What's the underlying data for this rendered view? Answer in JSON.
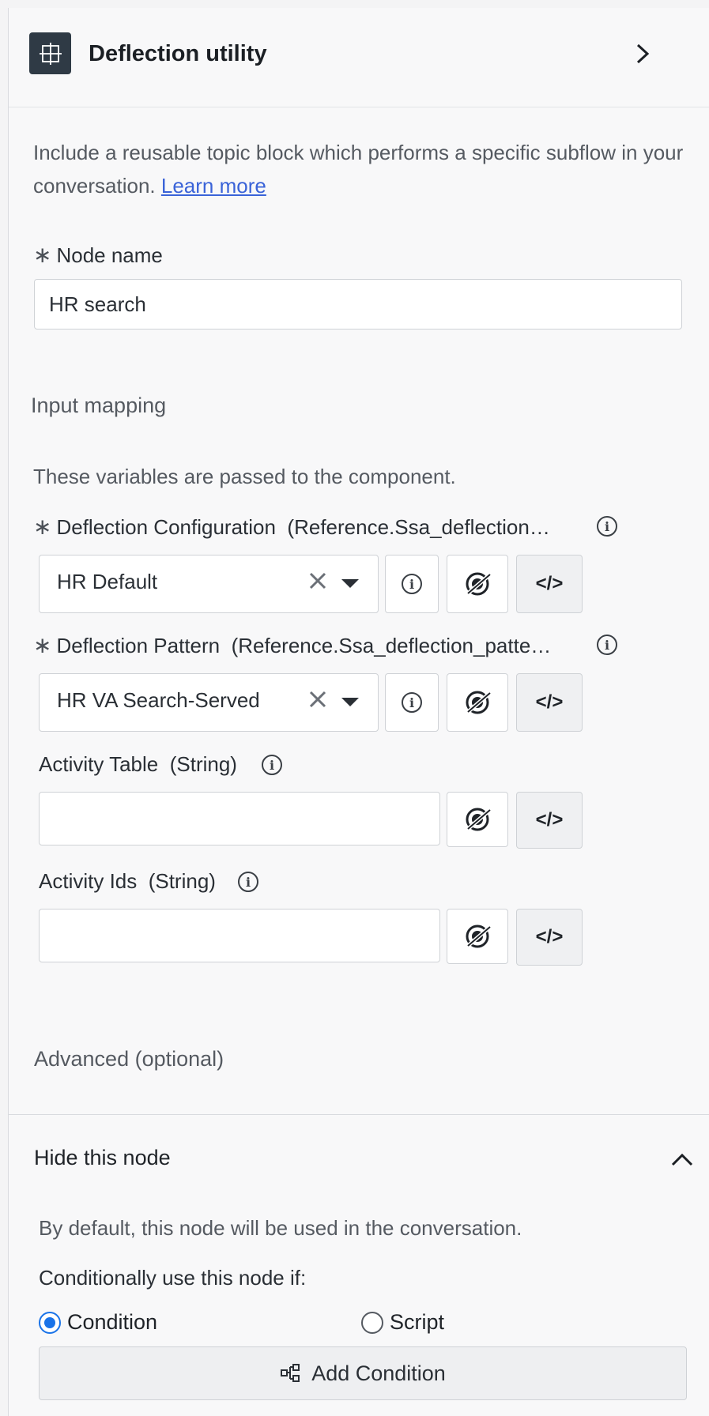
{
  "header": {
    "title": "Deflection utility",
    "icon": "grid-block-icon",
    "expand_icon": "chevron-right-icon"
  },
  "description": {
    "text": "Include a reusable topic block which performs a specific subflow in your conversation.",
    "link": "Learn more"
  },
  "node_name": {
    "required_mark": "∗",
    "label": "Node name",
    "value": "HR search"
  },
  "input_mapping": {
    "title": "Input mapping",
    "subtitle": "These variables are passed to the component.",
    "fields": [
      {
        "required_mark": "∗",
        "label": "Deflection Configuration",
        "type": "(Reference.Ssa_deflection…",
        "value": "HR Default"
      },
      {
        "required_mark": "∗",
        "label": "Deflection Pattern",
        "type": "(Reference.Ssa_deflection_patte…",
        "value": "HR VA Search-Served"
      },
      {
        "label": "Activity Table",
        "type": "(String)",
        "value": ""
      },
      {
        "label": "Activity Ids",
        "type": "(String)",
        "value": ""
      }
    ],
    "code_symbol": "</>"
  },
  "advanced": {
    "title": "Advanced (optional)"
  },
  "hide_node": {
    "title": "Hide this node",
    "default_text": "By default, this node will be used in the conversation.",
    "condition_prompt": "Conditionally use this node if:",
    "options": [
      "Condition",
      "Script"
    ],
    "selected": "Condition",
    "add_button": "Add Condition"
  },
  "colors": {
    "accent": "#1a73e8",
    "link": "#3a63d8",
    "logo_bg": "#2f3a45"
  }
}
